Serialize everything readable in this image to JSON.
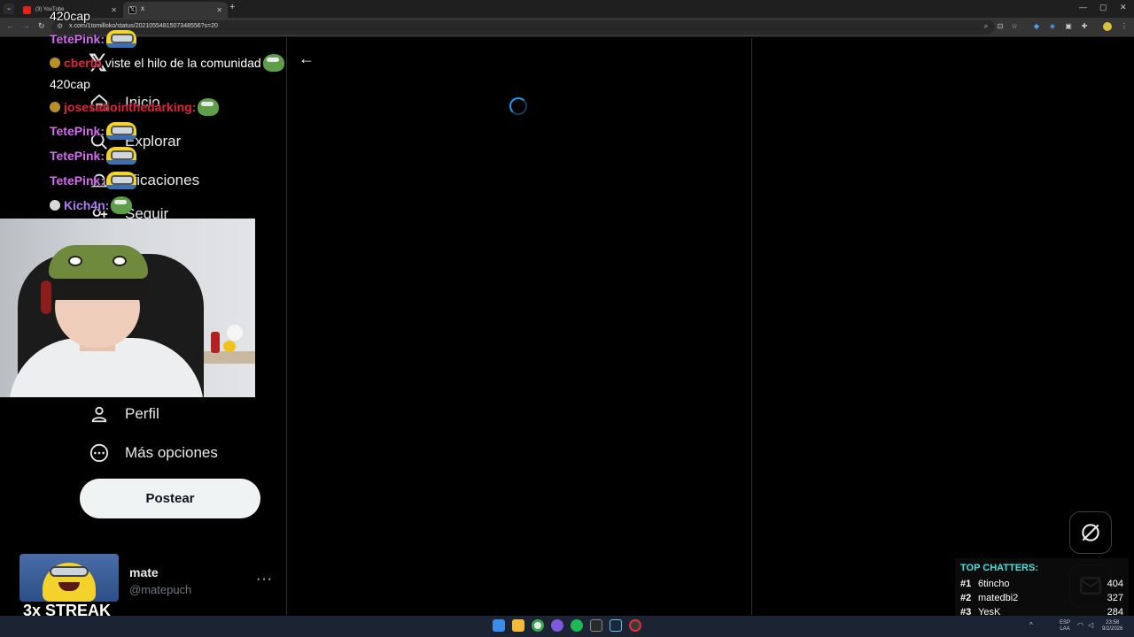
{
  "browser": {
    "tabs": [
      {
        "label": "(3) YouTube",
        "active": false
      },
      {
        "label": "X",
        "active": true
      }
    ],
    "url": "x.com/1tomilloko/status/2021055481507348556?s=20"
  },
  "x_nav": {
    "items": [
      {
        "label": "Inicio",
        "icon": "home-icon"
      },
      {
        "label": "Explorar",
        "icon": "search-icon"
      },
      {
        "label": "tificaciones",
        "icon": "bell-icon"
      },
      {
        "label": "Seguir",
        "icon": "follow-icon"
      },
      {
        "label": "Perfil",
        "icon": "person-icon"
      },
      {
        "label": "Más opciones",
        "icon": "more-circle-icon"
      }
    ],
    "post_button": "Postear",
    "account": {
      "name": "mate",
      "handle": "@matepuch",
      "more": "···"
    }
  },
  "chat": [
    {
      "user": "420cap",
      "color": "#ffffff",
      "message": ""
    },
    {
      "user": "TetePink:",
      "color": "#d46cf0",
      "message": "",
      "emote": "minion"
    },
    {
      "user": "cberto",
      "color": "#e0243c",
      "message": "viste el hilo de la comunidad",
      "emote": "pepe"
    },
    {
      "user": "420cap",
      "color": "#ffffff",
      "message": ""
    },
    {
      "user": "josesatiointhedarking:",
      "color": "#e0243c",
      "message": "",
      "emote": "pepe"
    },
    {
      "user": "TetePink:",
      "color": "#d46cf0",
      "message": "",
      "emote": "minion"
    },
    {
      "user": "TetePink:",
      "color": "#d46cf0",
      "message": "",
      "emote": "minion"
    },
    {
      "user": "TetePink:",
      "color": "#d46cf0",
      "message": "",
      "emote": "minion"
    },
    {
      "user": "Kich4n:",
      "color": "#b07cf2",
      "message": "",
      "emote": "pepe"
    }
  ],
  "streak": {
    "label": "3x STREAK"
  },
  "top_chatters": {
    "title": "TOP CHATTERS:",
    "rows": [
      {
        "rank": "#1",
        "name": "6tincho",
        "count": "404"
      },
      {
        "rank": "#2",
        "name": "matedbi2",
        "count": "327"
      },
      {
        "rank": "#3",
        "name": "YesK",
        "count": "284"
      }
    ]
  },
  "taskbar": {
    "lang": "ESP",
    "lang2": "LAA",
    "time": "23:58",
    "date": "9/2/2026"
  },
  "colors": {
    "accent": "#1d9bf0",
    "chatters_title": "#49e0dc",
    "background": "#000000"
  }
}
